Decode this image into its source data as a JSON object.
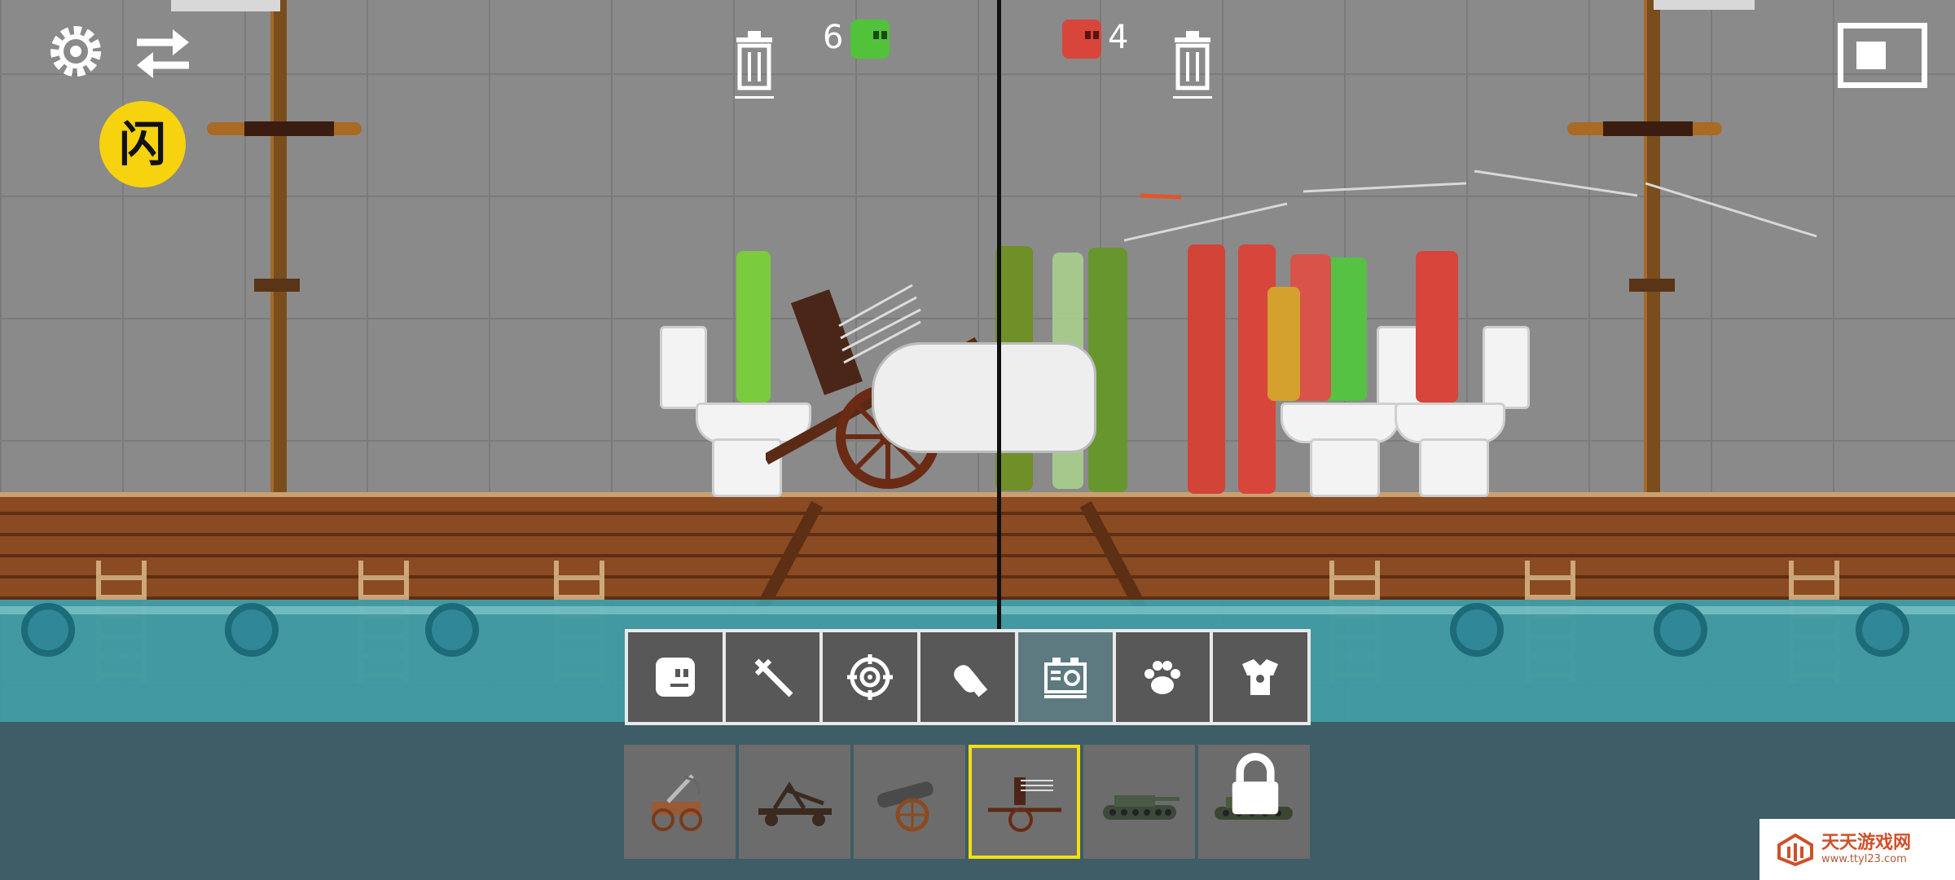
{
  "hud": {
    "settings_icon": "gear-icon",
    "swap_icon": "swap-arrows-icon",
    "flash_label": "闪",
    "trash_icon": "trash-icon",
    "team_green_count": "6",
    "team_red_count": "4",
    "layout_icon": "split-view-icon",
    "colors": {
      "green_team": "#52c23a",
      "red_team": "#d8453b",
      "flash_bg": "#f7d20e",
      "selected_border": "#f2e011"
    }
  },
  "categories": [
    {
      "name": "characters",
      "icon": "ragdoll-face-icon",
      "active": false
    },
    {
      "name": "melee",
      "icon": "swords-icon",
      "active": false
    },
    {
      "name": "firearms",
      "icon": "crosshair-icon",
      "active": false
    },
    {
      "name": "explosives",
      "icon": "bomb-icon",
      "active": false
    },
    {
      "name": "machines",
      "icon": "machine-gear-icon",
      "active": true
    },
    {
      "name": "animals",
      "icon": "paw-icon",
      "active": false
    },
    {
      "name": "armor",
      "icon": "armor-icon",
      "active": false
    }
  ],
  "items": [
    {
      "name": "ballista-cart",
      "selected": false,
      "locked": false
    },
    {
      "name": "catapult",
      "selected": false,
      "locked": false
    },
    {
      "name": "cannon",
      "selected": false,
      "locked": false
    },
    {
      "name": "arrow-launcher-cart",
      "selected": true,
      "locked": false
    },
    {
      "name": "tank",
      "selected": false,
      "locked": false
    },
    {
      "name": "missile-vehicle",
      "selected": false,
      "locked": true
    }
  ],
  "watermark": {
    "name": "天天游戏网",
    "url": "www.ttyl23.com"
  }
}
